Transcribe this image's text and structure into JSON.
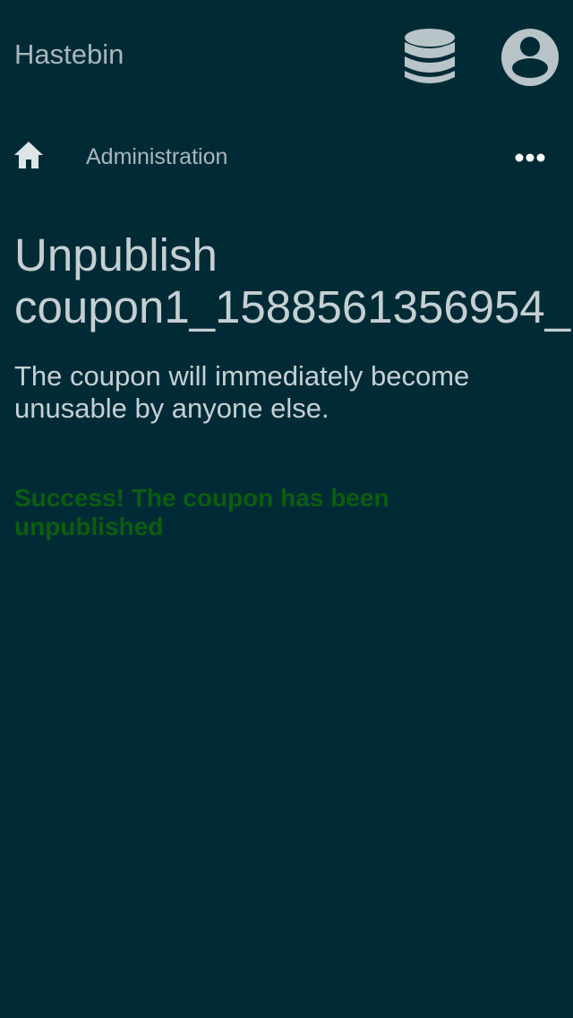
{
  "header": {
    "brand": "Hastebin",
    "database_icon": "database-icon",
    "account_icon": "user-circle-icon"
  },
  "breadcrumb": {
    "home_icon": "home-icon",
    "current": "Administration",
    "more_icon": "more-horizontal-icon"
  },
  "main": {
    "title_line1": "Unpublish",
    "title_line2": "coupon1_1588561356954_",
    "description": "The coupon will immediately become unusable by anyone else.",
    "success_message": "Success! The coupon has been unpublished"
  },
  "colors": {
    "background": "#002b36",
    "text": "#c5d0d3",
    "muted_text": "#a9b6bb",
    "icon": "#b9c4c8",
    "success": "#0b5e10"
  }
}
